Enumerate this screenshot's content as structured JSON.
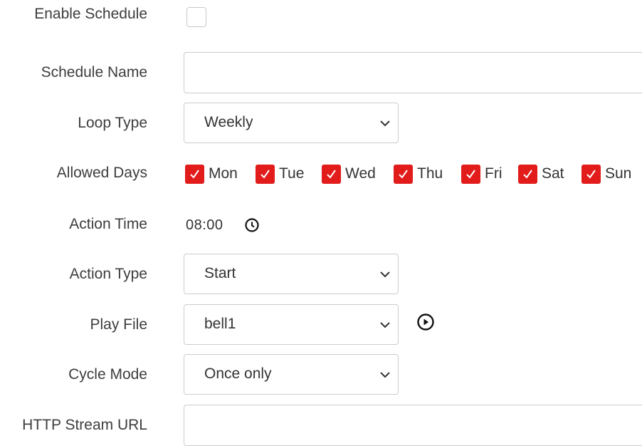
{
  "form": {
    "enable_schedule": {
      "label": "Enable Schedule",
      "checked": false
    },
    "schedule_name": {
      "label": "Schedule Name",
      "value": ""
    },
    "loop_type": {
      "label": "Loop Type",
      "value": "Weekly"
    },
    "allowed_days": {
      "label": "Allowed Days",
      "days": [
        {
          "label": "Mon",
          "checked": true
        },
        {
          "label": "Tue",
          "checked": true
        },
        {
          "label": "Wed",
          "checked": true
        },
        {
          "label": "Thu",
          "checked": true
        },
        {
          "label": "Fri",
          "checked": true
        },
        {
          "label": "Sat",
          "checked": true
        },
        {
          "label": "Sun",
          "checked": true
        }
      ]
    },
    "action_time": {
      "label": "Action Time",
      "value": "08:00",
      "icon": "clock-icon"
    },
    "action_type": {
      "label": "Action Type",
      "value": "Start"
    },
    "play_file": {
      "label": "Play File",
      "value": "bell1",
      "icon": "play-icon"
    },
    "cycle_mode": {
      "label": "Cycle Mode",
      "value": "Once only"
    },
    "http_stream_url": {
      "label": "HTTP Stream URL",
      "value": ""
    }
  },
  "colors": {
    "checkbox_checked": "#e21b1b",
    "border": "#cccccc",
    "label_text": "#3d3d3d"
  }
}
